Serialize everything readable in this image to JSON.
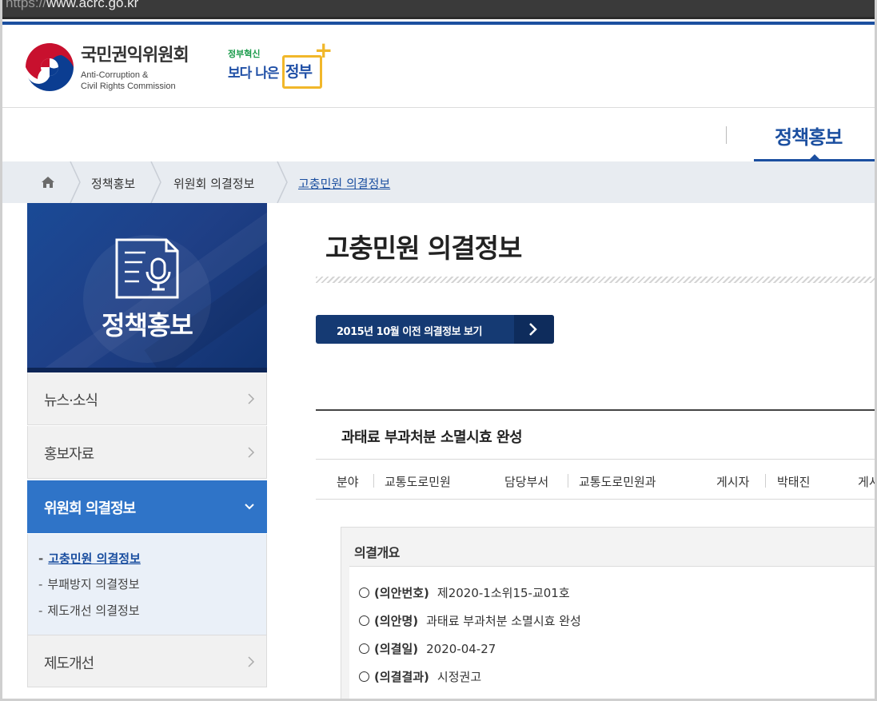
{
  "browser": {
    "url_scheme": "https://",
    "url_host": "www.acrc.go.kr"
  },
  "header": {
    "org_name_kr": "국민권익위원회",
    "org_name_en_line1": "Anti-Corruption &",
    "org_name_en_line2": "Civil Rights Commission",
    "gov_slogan_small": "정부혁신",
    "gov_slogan_big": "보다 나은",
    "gov_slogan_box": "정부",
    "gov_plus": "+"
  },
  "nav": {
    "active_menu": "정책홍보"
  },
  "breadcrumb": {
    "items": [
      "정책홍보",
      "위원회 의결정보",
      "고충민원 의결정보"
    ]
  },
  "sidebar": {
    "banner_title": "정책홍보",
    "items": [
      {
        "label": "뉴스·소식"
      },
      {
        "label": "홍보자료"
      },
      {
        "label": "위원회 의결정보"
      },
      {
        "label": "제도개선"
      }
    ],
    "submenu": [
      {
        "label": "고충민원 의결정보"
      },
      {
        "label": "부패방지 의결정보"
      },
      {
        "label": "제도개선 의결정보"
      }
    ]
  },
  "main": {
    "page_title": "고충민원 의결정보",
    "old_info_button": "2015년 10월 이전 의결정보 보기",
    "article_title": "과태료 부과처분 소멸시효 완성",
    "meta": {
      "field_label": "분야",
      "field_value": "교통도로민원",
      "dept_label": "담당부서",
      "dept_value": "교통도로민원과",
      "poster_label": "게시자",
      "poster_value": "박태진",
      "date_label_partial": "게시"
    },
    "summary": {
      "heading": "의결개요",
      "rows": [
        {
          "key": "(의안번호)",
          "value": "제2020-1소위15-교01호"
        },
        {
          "key": "(의안명)",
          "value": "과태료 부과처분 소멸시효 완성"
        },
        {
          "key": "(의결일)",
          "value": "2020-04-27"
        },
        {
          "key": "(의결결과)",
          "value": "시정권고"
        }
      ]
    }
  },
  "colors": {
    "brand_blue": "#1b4fa0",
    "active_side": "#2f74c8",
    "button_navy": "#153a73",
    "gov_yellow": "#f1b72a"
  },
  "icons": {
    "home": "home-icon",
    "chevron": "chevron-right-icon",
    "doc": "document-microphone-icon"
  }
}
